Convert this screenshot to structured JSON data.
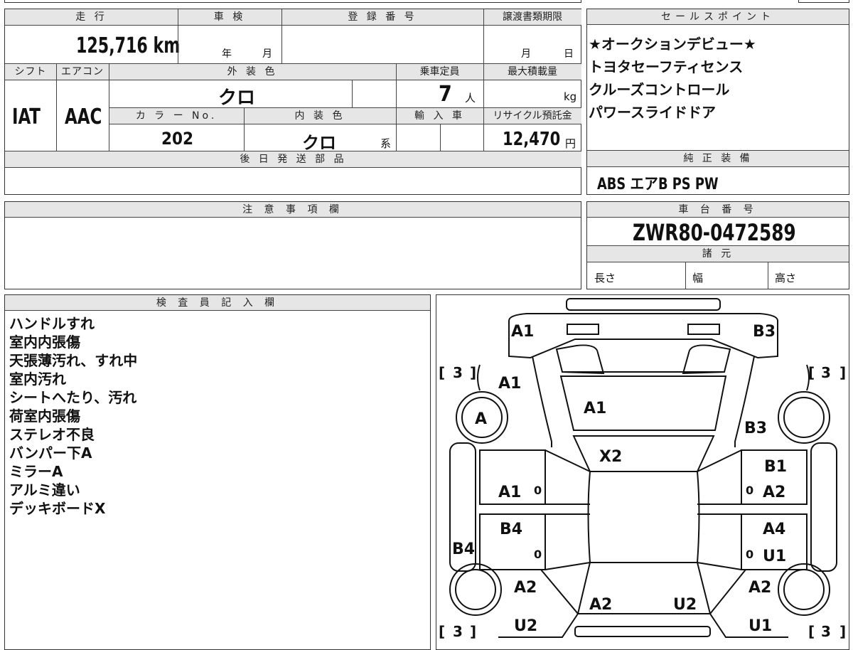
{
  "top_strip": "",
  "summary": {
    "mileage_label": "走 行",
    "mileage_value": "125,716 km",
    "inspection_label": "車 検",
    "inspection_year": "年",
    "inspection_month": "月",
    "registration_label": "登 録 番 号",
    "transfer_label": "譲渡書類期限",
    "transfer_month": "月",
    "transfer_day": "日",
    "shift_label": "シフト",
    "shift_value": "IAT",
    "aircon_label": "エアコン",
    "aircon_value": "AAC",
    "exterior_label": "外 装 色",
    "exterior_value": "クロ",
    "capacity_label": "乗車定員",
    "capacity_value": "7",
    "capacity_unit": "人",
    "load_label": "最大積載量",
    "load_unit": "kg",
    "color_no_label": "カ ラ ー No.",
    "color_no_value": "202",
    "interior_label": "内 装 色",
    "interior_value": "クロ",
    "interior_suffix": "系",
    "import_label": "輸 入 車",
    "recycle_label": "リサイクル預託金",
    "recycle_value": "12,470",
    "recycle_unit": "円",
    "later_parts_label": "後 日 発 送 部 品"
  },
  "sales_points": {
    "title": "セールスポイント",
    "lines": [
      "★オークションデビュー★",
      "トヨタセーフティセンス",
      "クルーズコントロール",
      "パワースライドドア"
    ]
  },
  "equipment": {
    "title": "純 正 装 備",
    "value": "ABS エアB PS PW"
  },
  "notes": {
    "title": "注 意 事 項 欄"
  },
  "chassis": {
    "title": "車 台 番 号",
    "value": "ZWR80-0472589",
    "specs_title": "諸 元",
    "length": "長さ",
    "width": "幅",
    "height": "高さ"
  },
  "inspector": {
    "title": "検 査 員 記 入 欄",
    "lines": [
      "ハンドルすれ",
      "室内内張傷",
      "天張薄汚れ、すれ中",
      "室内汚れ",
      "シートへたり、汚れ",
      "荷室内張傷",
      "ステレオ不良",
      "バンパー下A",
      "ミラーA",
      "アルミ違い",
      "デッキボードX"
    ]
  },
  "diagram": {
    "marks": {
      "front_left": "A1",
      "front_right": "B3",
      "fender_left": "A1",
      "hood": "A1",
      "wheel_left_front": "A",
      "fender_right": "B3",
      "windshield": "X2",
      "pillar_right": "B1",
      "door_left_front": "A1",
      "door_right_front": "A2",
      "door_left_rear": "B4",
      "door_right_rear": "A4",
      "side_left": "B4",
      "side_right": "U1",
      "quarter_left": "A2",
      "quarter_right": "A2",
      "rear_left": "A2",
      "rear_right": "U2",
      "bumper_left": "U2",
      "bumper_right": "U1",
      "zero": "0",
      "tire_tread": "3"
    }
  }
}
